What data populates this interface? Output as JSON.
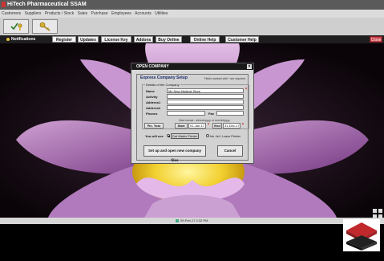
{
  "window": {
    "title": "HiTech Pharmaceutical SSAM"
  },
  "menu": [
    "Customers",
    "Suppliers",
    "Products / Stock",
    "Sales",
    "Purchase",
    "Employees",
    "Accounts",
    "Utilities"
  ],
  "toolbar": {
    "buttons": [
      {
        "icon": "check-key-icon"
      },
      {
        "icon": "key-icon"
      }
    ]
  },
  "navbar": {
    "notifications_label": "Notifications",
    "buttons": [
      "Register",
      "Updates",
      "License Key",
      "Addons",
      "Buy Online",
      "Online Help",
      "Customer Help"
    ],
    "close_label": "Close"
  },
  "dialog": {
    "title": "OPEN COMPANY",
    "panel_title": "Express Company Setup",
    "required_note": "Fields marked with * are required",
    "group_title": "Details of the Company",
    "fields": {
      "name": {
        "label": "Name",
        "value": "My New Medical Store"
      },
      "activity": {
        "label": "Activity",
        "value": ""
      },
      "address1": {
        "label": "Address1",
        "value": ""
      },
      "address2": {
        "label": "Address2",
        "value": ""
      },
      "phones": {
        "label": "Phones",
        "value": ""
      },
      "fax": {
        "label": "Fax",
        "value": ""
      }
    },
    "date_hint": "Date format : dd/mm/yyyy or mm/dd/yyyy",
    "fin_year_label": "Fin. Year",
    "start_label": "Start",
    "start_value": "01-Jan-17",
    "end_label": "End",
    "end_value": "31-Dec-17",
    "use_label": "You will use",
    "printer_options": [
      "Dot Matrix Printer",
      "Ink Jet / Laser Printer"
    ],
    "printer_selected": 0,
    "setup_button": "Set up and open new company files",
    "cancel_button": "Cancel"
  },
  "status": {
    "datetime": "09-Feb-17  2:32 PM"
  },
  "colors": {
    "accent_close": "#c8404a",
    "required_star": "#cc0000",
    "panel_title": "#1a2a6a"
  }
}
